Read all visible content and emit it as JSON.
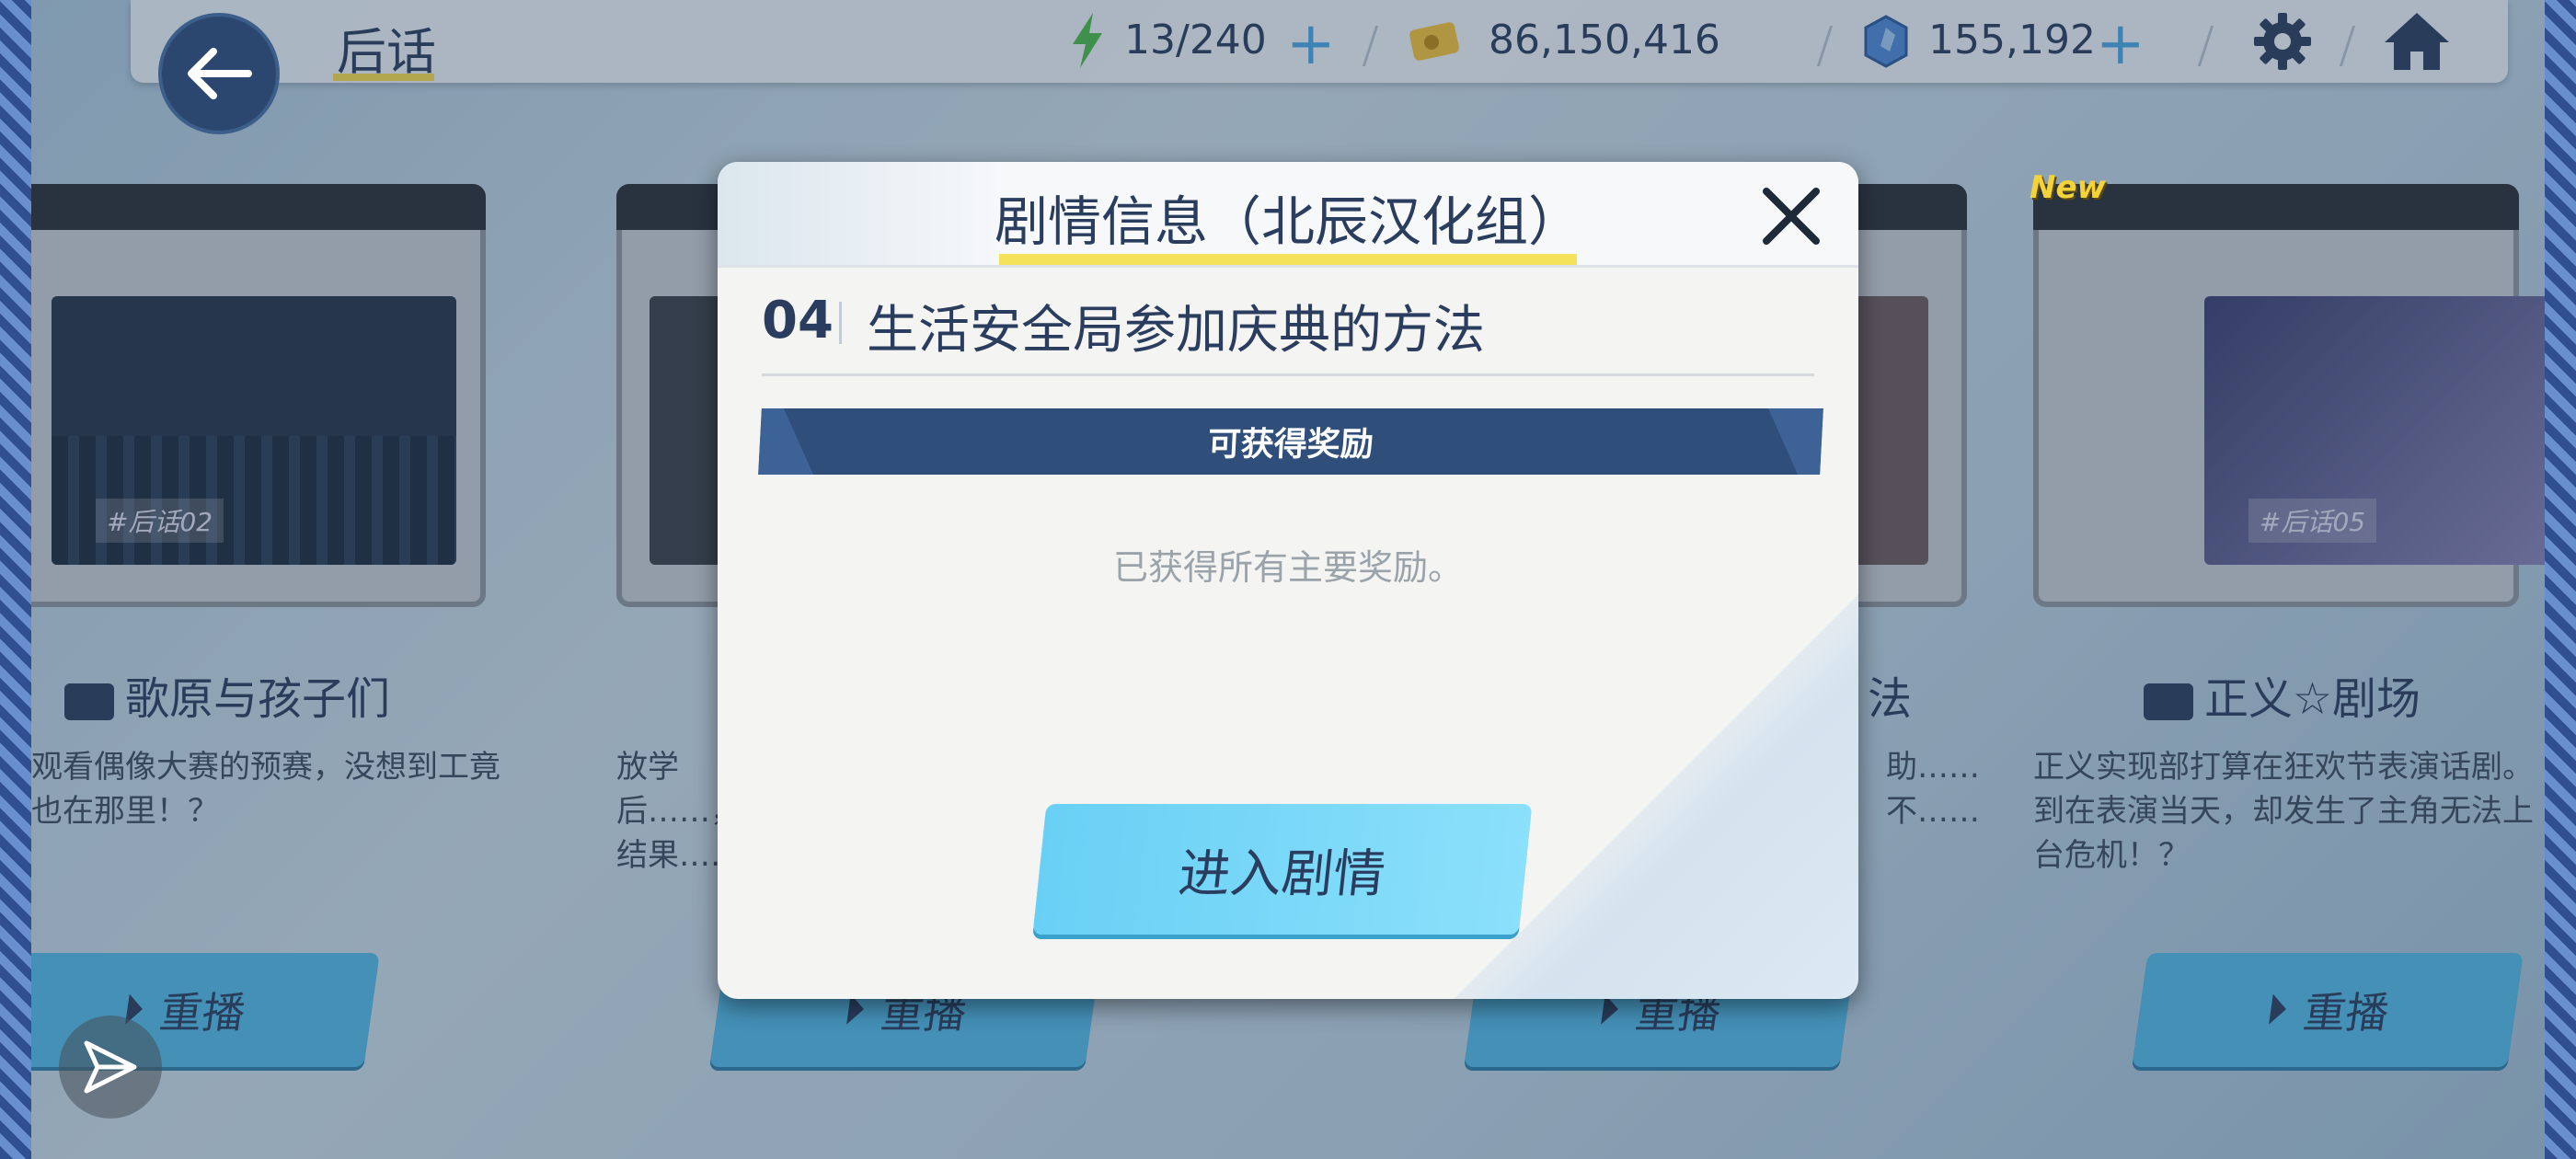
{
  "topbar": {
    "title": "后话",
    "stamina": "13/240",
    "credits": "86,150,416",
    "gems": "155,192"
  },
  "cards": [
    {
      "tag": "#后话02",
      "title": "歌原与孩子们",
      "desc": "去观看偶像大赛的预赛，没想到工竟然也在那里！？",
      "replay": "重播"
    },
    {
      "tag": "",
      "title": "",
      "desc": "放学后……，结果……",
      "replay": "重播"
    },
    {
      "tag": "",
      "title": "法",
      "desc": "助……不……",
      "replay": "重播"
    },
    {
      "tag": "#后话05",
      "title": "正义☆剧场",
      "desc": "正义实现部打算在狂欢节表演话剧。到在表演当天，却发生了主角无法上台危机！？",
      "replay": "重播",
      "badge": "New"
    }
  ],
  "modal": {
    "title": "剧情信息（北辰汉化组）",
    "episode_number": "04",
    "episode_title": "生活安全局参加庆典的方法",
    "reward_header": "可获得奖励",
    "reward_text": "已获得所有主要奖励。",
    "enter_button": "进入剧情"
  },
  "colors": {
    "accent": "#2f4e79",
    "highlight": "#f5e25b",
    "button": "#69d0f5"
  }
}
